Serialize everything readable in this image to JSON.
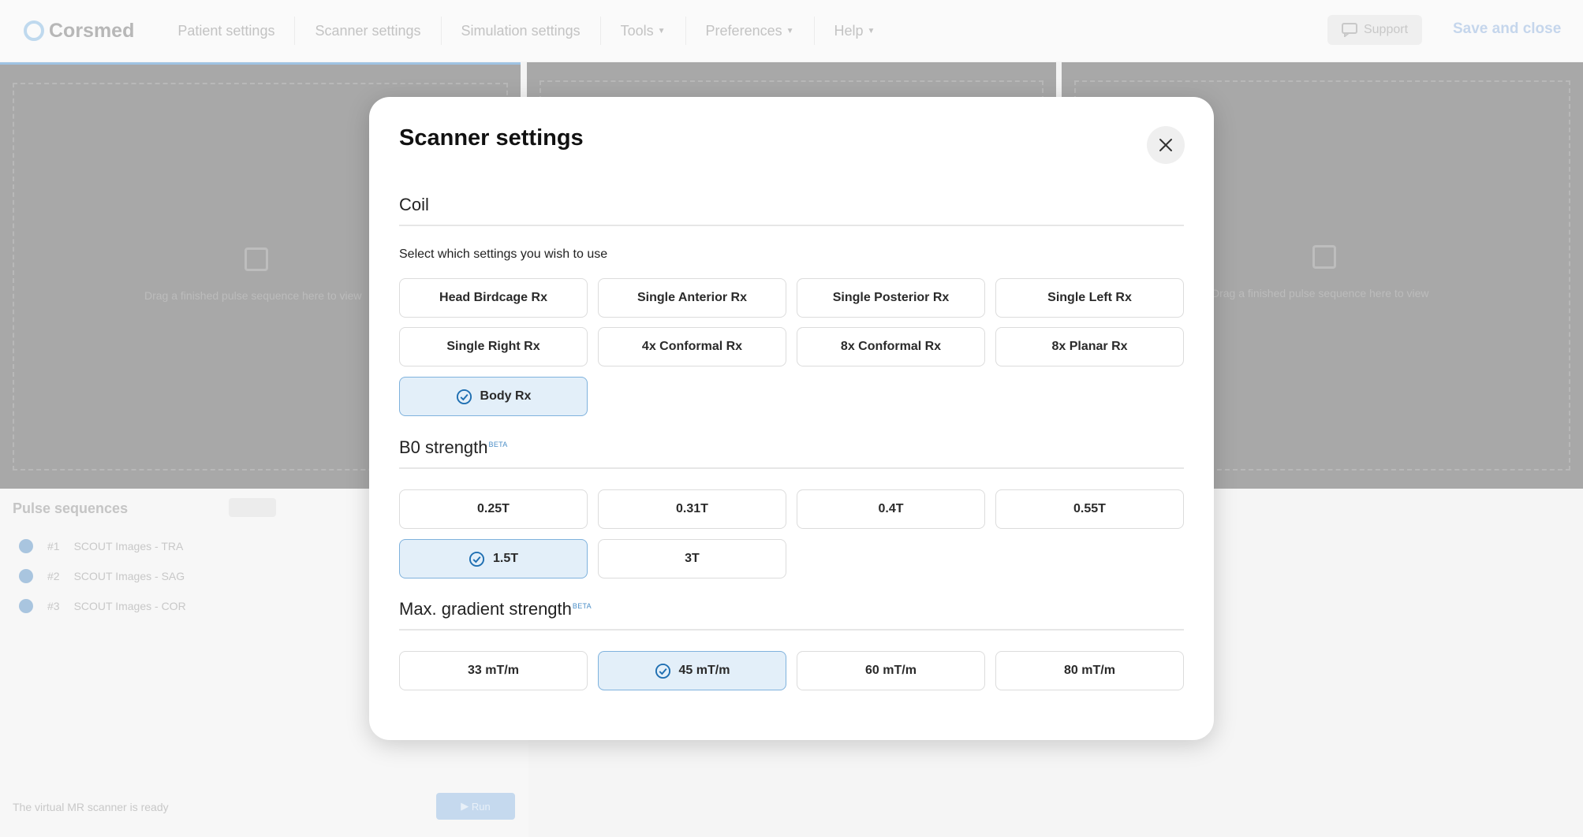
{
  "topbar": {
    "logo_text": "Corsmed",
    "nav": [
      {
        "label": "Patient settings",
        "caret": false
      },
      {
        "label": "Scanner settings",
        "caret": false
      },
      {
        "label": "Simulation settings",
        "caret": false
      },
      {
        "label": "Tools",
        "caret": true
      },
      {
        "label": "Preferences",
        "caret": true
      },
      {
        "label": "Help",
        "caret": true
      }
    ],
    "support_label": "Support",
    "save_close_label": "Save and close"
  },
  "viewports": {
    "drop_hint": "Drag a finished pulse sequence here to view"
  },
  "pulse_panel": {
    "title": "Pulse sequences",
    "rows": [
      {
        "num": "#1",
        "name": "SCOUT Images - TRA"
      },
      {
        "num": "#2",
        "name": "SCOUT Images - SAG"
      },
      {
        "num": "#3",
        "name": "SCOUT Images - COR"
      }
    ],
    "status": "The virtual MR scanner is ready",
    "run_label": "Run"
  },
  "modal": {
    "title": "Scanner settings",
    "coil": {
      "heading": "Coil",
      "hint": "Select which settings you wish to use",
      "options": [
        {
          "label": "Head Birdcage Rx",
          "selected": false
        },
        {
          "label": "Single Anterior Rx",
          "selected": false
        },
        {
          "label": "Single Posterior Rx",
          "selected": false
        },
        {
          "label": "Single Left Rx",
          "selected": false
        },
        {
          "label": "Single Right Rx",
          "selected": false
        },
        {
          "label": "4x Conformal Rx",
          "selected": false
        },
        {
          "label": "8x Conformal Rx",
          "selected": false
        },
        {
          "label": "8x Planar Rx",
          "selected": false
        },
        {
          "label": "Body Rx",
          "selected": true
        }
      ]
    },
    "b0": {
      "heading": "B0 strength",
      "badge": "BETA",
      "options": [
        {
          "label": "0.25T",
          "selected": false
        },
        {
          "label": "0.31T",
          "selected": false
        },
        {
          "label": "0.4T",
          "selected": false
        },
        {
          "label": "0.55T",
          "selected": false
        },
        {
          "label": "1.5T",
          "selected": true
        },
        {
          "label": "3T",
          "selected": false
        }
      ]
    },
    "gradient": {
      "heading": "Max. gradient strength",
      "badge": "BETA",
      "options": [
        {
          "label": "33 mT/m",
          "selected": false
        },
        {
          "label": "45 mT/m",
          "selected": true
        },
        {
          "label": "60 mT/m",
          "selected": false
        },
        {
          "label": "80 mT/m",
          "selected": false
        }
      ]
    }
  },
  "colors": {
    "accent": "#1f6fb2",
    "selected_bg": "#e3eff9",
    "selected_border": "#7fb2dd"
  }
}
